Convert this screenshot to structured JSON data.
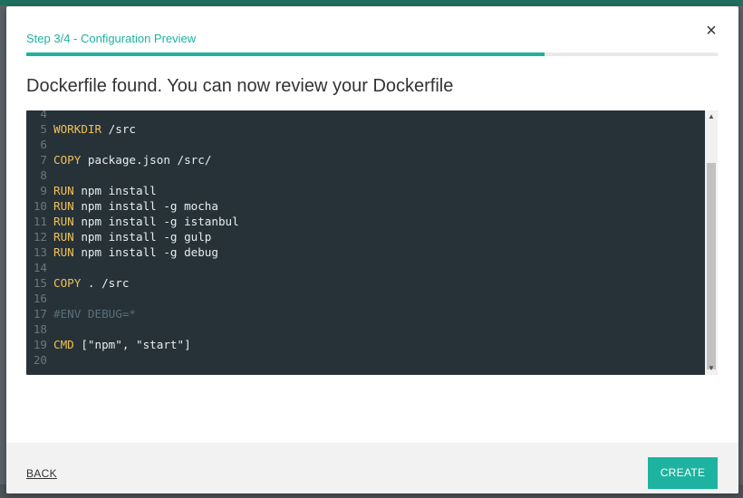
{
  "wizard": {
    "step_label": "Step 3/4 - Configuration Preview",
    "progress": 0.75,
    "close_glyph": "×",
    "heading": "Dockerfile found. You can now review your Dockerfile"
  },
  "dockerfile": {
    "lines": [
      {
        "n": "4",
        "kw": "",
        "rest": ""
      },
      {
        "n": "5",
        "kw": "WORKDIR",
        "rest": " /src"
      },
      {
        "n": "6",
        "kw": "",
        "rest": ""
      },
      {
        "n": "7",
        "kw": "COPY",
        "rest": " package.json /src/"
      },
      {
        "n": "8",
        "kw": "",
        "rest": ""
      },
      {
        "n": "9",
        "kw": "RUN",
        "rest": " npm install"
      },
      {
        "n": "10",
        "kw": "RUN",
        "rest": " npm install -g mocha"
      },
      {
        "n": "11",
        "kw": "RUN",
        "rest": " npm install -g istanbul"
      },
      {
        "n": "12",
        "kw": "RUN",
        "rest": " npm install -g gulp"
      },
      {
        "n": "13",
        "kw": "RUN",
        "rest": " npm install -g debug"
      },
      {
        "n": "14",
        "kw": "",
        "rest": ""
      },
      {
        "n": "15",
        "kw": "COPY",
        "rest": " . /src"
      },
      {
        "n": "16",
        "kw": "",
        "rest": ""
      },
      {
        "n": "17",
        "kw": "",
        "rest": "",
        "comment": "#ENV DEBUG=*"
      },
      {
        "n": "18",
        "kw": "",
        "rest": ""
      },
      {
        "n": "19",
        "kw": "CMD",
        "rest": " [\"npm\", \"start\"]"
      },
      {
        "n": "20",
        "kw": "",
        "rest": ""
      }
    ]
  },
  "footer": {
    "back_label": "BACK",
    "create_label": "CREATE"
  },
  "colors": {
    "accent": "#1db3a0",
    "editor_bg": "#263238",
    "keyword": "#f0c05a"
  }
}
